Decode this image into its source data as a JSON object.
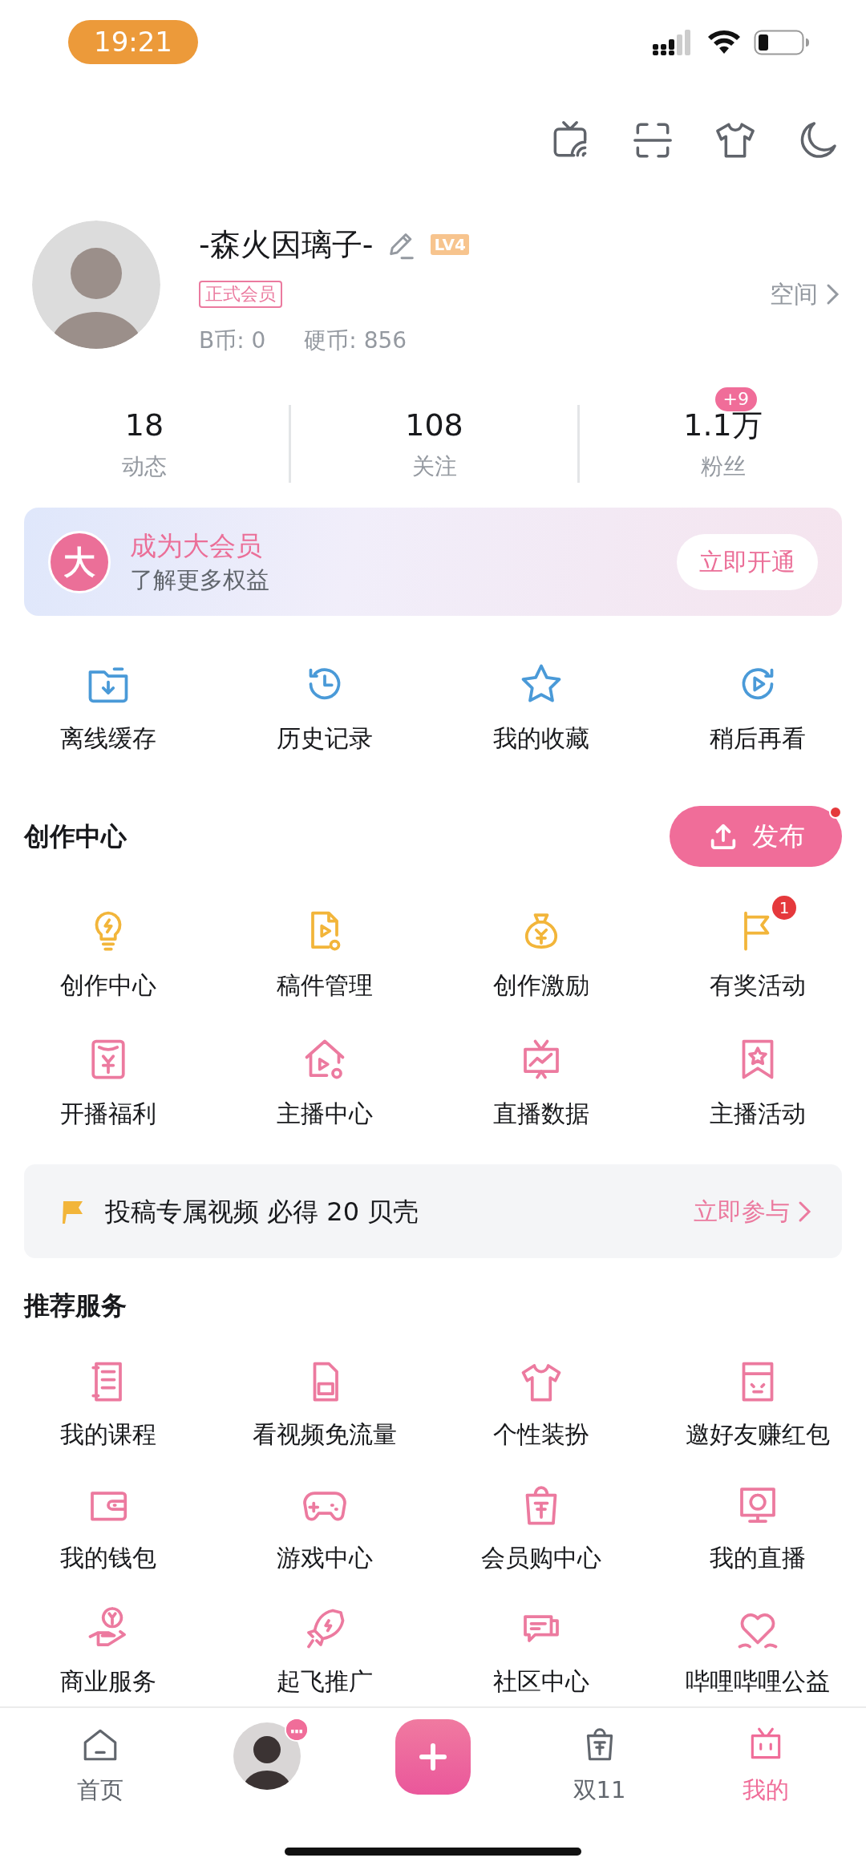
{
  "status_bar": {
    "time": "19:21"
  },
  "profile": {
    "name": "-森火因璃子-",
    "level": "LV4",
    "member_badge": "正式会员",
    "b_coins": "B币: 0",
    "coins": "硬币: 856",
    "space_link": "空间"
  },
  "stats": [
    {
      "value": "18",
      "label": "动态"
    },
    {
      "value": "108",
      "label": "关注"
    },
    {
      "value": "1.1万",
      "label": "粉丝",
      "badge": "+9"
    }
  ],
  "vip_banner": {
    "icon_text": "大",
    "title": "成为大会员",
    "subtitle": "了解更多权益",
    "button": "立即开通"
  },
  "quick_actions": [
    {
      "label": "离线缓存"
    },
    {
      "label": "历史记录"
    },
    {
      "label": "我的收藏"
    },
    {
      "label": "稍后再看"
    }
  ],
  "creation": {
    "title": "创作中心",
    "publish_button": "发布",
    "publish_dot": true,
    "items": [
      {
        "label": "创作中心",
        "color": "#f2b53a"
      },
      {
        "label": "稿件管理",
        "color": "#f2b53a"
      },
      {
        "label": "创作激励",
        "color": "#f2b53a"
      },
      {
        "label": "有奖活动",
        "color": "#f2b53a",
        "badge": "1"
      },
      {
        "label": "开播福利",
        "color": "#ec7a9f"
      },
      {
        "label": "主播中心",
        "color": "#ec7a9f"
      },
      {
        "label": "直播数据",
        "color": "#ec7a9f"
      },
      {
        "label": "主播活动",
        "color": "#ec7a9f"
      }
    ]
  },
  "promo": {
    "text": "投稿专属视频 必得 20 贝壳",
    "link": "立即参与"
  },
  "services": {
    "title": "推荐服务",
    "items": [
      {
        "label": "我的课程"
      },
      {
        "label": "看视频免流量"
      },
      {
        "label": "个性装扮"
      },
      {
        "label": "邀好友赚红包"
      },
      {
        "label": "我的钱包"
      },
      {
        "label": "游戏中心"
      },
      {
        "label": "会员购中心"
      },
      {
        "label": "我的直播"
      },
      {
        "label": "商业服务"
      },
      {
        "label": "起飞推广"
      },
      {
        "label": "社区中心"
      },
      {
        "label": "哔哩哔哩公益"
      }
    ]
  },
  "tab_bar": [
    {
      "kind": "icon",
      "label": "首页",
      "selected": false
    },
    {
      "kind": "avatar",
      "selected": false
    },
    {
      "kind": "add",
      "selected": false
    },
    {
      "kind": "icon",
      "label": "双11",
      "selected": false
    },
    {
      "kind": "icon",
      "label": "我的",
      "selected": true
    }
  ]
}
